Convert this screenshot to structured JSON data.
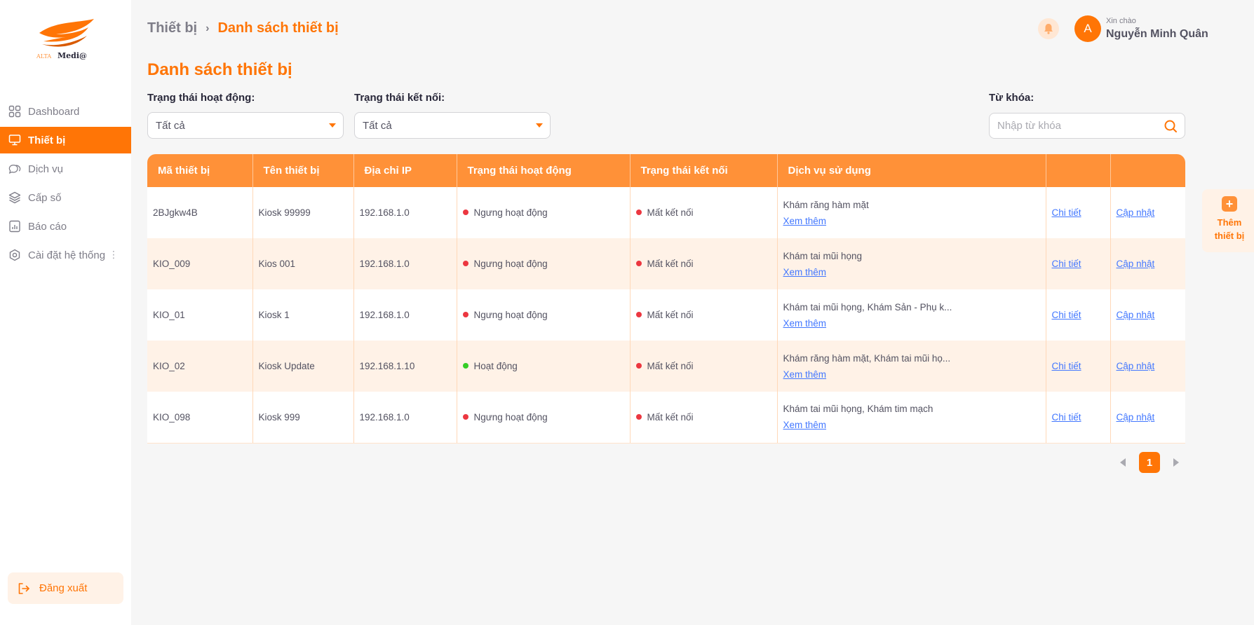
{
  "brand": {
    "logo_text_left": "ALTA",
    "logo_text_right": "Medi@",
    "accent": "#ff7506"
  },
  "sidebar": {
    "items": [
      {
        "label": "Dashboard",
        "icon": "dashboard-icon",
        "active": false
      },
      {
        "label": "Thiết bị",
        "icon": "monitor-icon",
        "active": true
      },
      {
        "label": "Dịch vụ",
        "icon": "chat-bubbles-icon",
        "active": false
      },
      {
        "label": "Cấp số",
        "icon": "layers-icon",
        "active": false
      },
      {
        "label": "Báo cáo",
        "icon": "report-icon",
        "active": false
      },
      {
        "label": "Cài đặt hệ thống",
        "icon": "settings-icon",
        "active": false
      }
    ],
    "logout_label": "Đăng xuất"
  },
  "header": {
    "breadcrumb": [
      "Thiết bị",
      "Danh sách thiết bị"
    ],
    "greeting": "Xin chào",
    "user_name": "Nguyễn Minh Quân",
    "avatar_initial": "A"
  },
  "page_title": "Danh sách thiết bị",
  "filters": {
    "active_status": {
      "label": "Trạng thái hoạt động:",
      "value": "Tất cả"
    },
    "connection_status": {
      "label": "Trạng thái kết nối:",
      "value": "Tất cả"
    },
    "keyword": {
      "label": "Từ khóa:",
      "placeholder": "Nhập từ khóa"
    }
  },
  "table": {
    "columns": [
      "Mã thiết bị",
      "Tên thiết bị",
      "Địa chỉ IP",
      "Trạng thái hoạt động",
      "Trạng thái kết nối",
      "Dịch vụ sử dụng",
      "",
      ""
    ],
    "more_label": "Xem thêm",
    "detail_label": "Chi tiết",
    "update_label": "Cập nhật",
    "rows": [
      {
        "code": "2BJgkw4B",
        "name": "Kiosk 99999",
        "ip": "192.168.1.0",
        "active": "Ngưng hoạt động",
        "active_color": "red",
        "connection": "Mất kết nối",
        "connection_color": "red",
        "services": "Khám răng hàm mặt"
      },
      {
        "code": "KIO_009",
        "name": "Kios 001",
        "ip": "192.168.1.0",
        "active": "Ngưng hoạt động",
        "active_color": "red",
        "connection": "Mất kết nối",
        "connection_color": "red",
        "services": "Khám tai mũi họng"
      },
      {
        "code": "KIO_01",
        "name": "Kiosk 1",
        "ip": "192.168.1.0",
        "active": "Ngưng hoạt động",
        "active_color": "red",
        "connection": "Mất kết nối",
        "connection_color": "red",
        "services": "Khám tai mũi họng, Khám Sản - Phụ k..."
      },
      {
        "code": "KIO_02",
        "name": "Kiosk Update",
        "ip": "192.168.1.10",
        "active": "Hoạt động",
        "active_color": "green",
        "connection": "Mất kết nối",
        "connection_color": "red",
        "services": "Khám răng hàm mặt, Khám tai mũi họ..."
      },
      {
        "code": "KIO_098",
        "name": "Kiosk 999",
        "ip": "192.168.1.0",
        "active": "Ngưng hoạt động",
        "active_color": "red",
        "connection": "Mất kết nối",
        "connection_color": "red",
        "services": "Khám tai mũi họng, Khám tim mạch"
      }
    ]
  },
  "pagination": {
    "current_page": "1"
  },
  "add_device": {
    "line1": "Thêm",
    "line2": "thiết bị"
  }
}
